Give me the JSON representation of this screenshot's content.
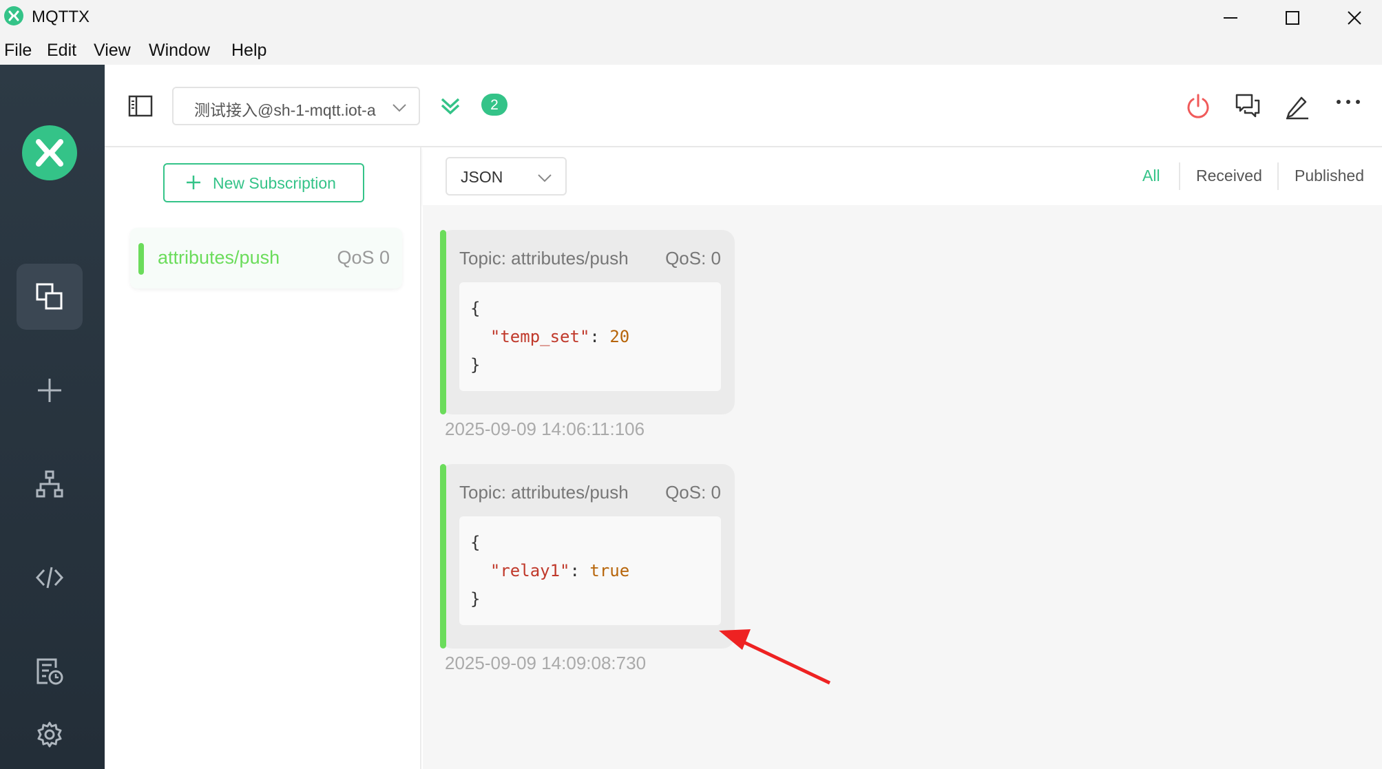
{
  "window": {
    "title": "MQTTX"
  },
  "menu": [
    "File",
    "Edit",
    "View",
    "Window",
    "Help"
  ],
  "toolbar": {
    "connection_name": "测试接入@sh-1-mqtt.iot-a",
    "unread_count": "2"
  },
  "subscriptions": {
    "new_button_label": "New Subscription",
    "items": [
      {
        "topic": "attributes/push",
        "qos": "QoS 0",
        "color": "#6bdc5b"
      }
    ]
  },
  "messages": {
    "format": "JSON",
    "filters": [
      "All",
      "Received",
      "Published"
    ],
    "active_filter": "All",
    "list": [
      {
        "topic": "Topic: attributes/push",
        "qos": "QoS: 0",
        "lines": [
          {
            "brace": "{"
          },
          {
            "key": "\"temp_set\"",
            "colon": ": ",
            "value": "20"
          },
          {
            "brace": "}"
          }
        ],
        "time": "2025-09-09 14:06:11:106"
      },
      {
        "topic": "Topic: attributes/push",
        "qos": "QoS: 0",
        "lines": [
          {
            "brace": "{"
          },
          {
            "key": "\"relay1\"",
            "colon": ": ",
            "value": "true"
          },
          {
            "brace": "}"
          }
        ],
        "time": "2025-09-09 14:09:08:730"
      }
    ]
  },
  "colors": {
    "accent": "#34c388",
    "topic_green": "#6bdc5b",
    "annotation_red": "#ee2222"
  }
}
